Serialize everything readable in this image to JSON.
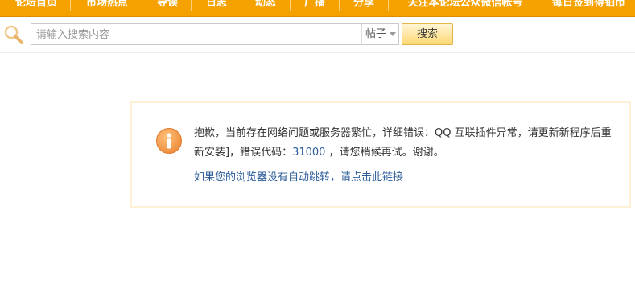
{
  "nav": {
    "items": [
      "论坛首页",
      "市场热点",
      "导读",
      "日志",
      "动态",
      "广播",
      "分享",
      "关注本论坛公众微信帐号",
      "每日签到得铂币"
    ]
  },
  "search": {
    "placeholder": "请输入搜索内容",
    "type_label": "帖子",
    "button_label": "搜索"
  },
  "alert": {
    "message_before": "抱歉，当前存在网络问题或服务器繁忙，详细错误：QQ 互联插件异常，请更新新程序后重新安装]，错误代码：",
    "error_code": "31000",
    "message_after": " ，请您稍候再试。谢谢。",
    "link_text": "如果您的浏览器没有自动跳转，请点击此链接"
  },
  "colors": {
    "nav_bg": "#f5a200",
    "link": "#2c5c9a",
    "alert_border": "#fff1d6",
    "alert_icon": "#f29a48"
  }
}
